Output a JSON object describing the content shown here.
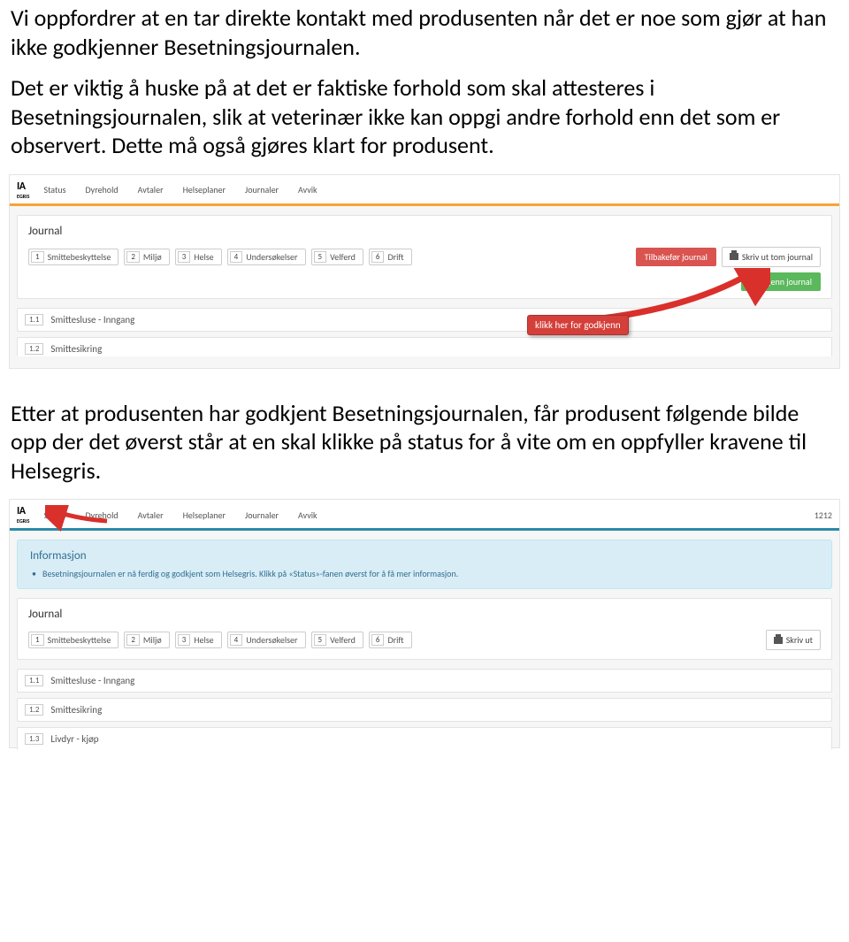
{
  "paragraphs": {
    "p1": "Vi oppfordrer at en tar direkte kontakt med produsenten når det er noe som gjør at han ikke godkjenner Besetningsjournalen.",
    "p2": "Det er viktig å huske på at det er faktiske forhold som skal attesteres i Besetningsjournalen, slik at veterinær ikke kan oppgi andre forhold enn det som er observert. Dette må også gjøres klart for produsent.",
    "p3": "Etter at produsenten har godkjent Besetningsjournalen, får produsent følgende bilde opp der det øverst står at en skal klikke på status for å vite om en oppfyller kravene til Helsegris."
  },
  "logo": {
    "main": "IA",
    "sub": "EGRIS"
  },
  "nav1": {
    "items": [
      "Status",
      "Dyrehold",
      "Avtaler",
      "Helseplaner",
      "Journaler",
      "Avvik"
    ]
  },
  "ss1": {
    "panel_title": "Journal",
    "tabs": [
      {
        "num": "1",
        "label": "Smittebeskyttelse"
      },
      {
        "num": "2",
        "label": "Miljø"
      },
      {
        "num": "3",
        "label": "Helse"
      },
      {
        "num": "4",
        "label": "Undersøkelser"
      },
      {
        "num": "5",
        "label": "Velferd"
      },
      {
        "num": "6",
        "label": "Drift"
      }
    ],
    "btn_red": "Tilbakefør journal",
    "btn_print": "Skriv ut tom journal",
    "btn_green": "Godkjenn journal",
    "subrows": [
      {
        "num": "1.1",
        "label": "Smittesluse - Inngang"
      },
      {
        "num": "1.2",
        "label": "Smittesikring"
      }
    ],
    "callout": "klikk her for godkjenn"
  },
  "ss2": {
    "topright": "1212",
    "info_title": "Informasjon",
    "info_text": "Besetningsjournalen er nå ferdig og godkjent som Helsegris. Klikk på «Status»-fanen øverst for å få mer informasjon.",
    "panel_title": "Journal",
    "tabs": [
      {
        "num": "1",
        "label": "Smittebeskyttelse"
      },
      {
        "num": "2",
        "label": "Miljø"
      },
      {
        "num": "3",
        "label": "Helse"
      },
      {
        "num": "4",
        "label": "Undersøkelser"
      },
      {
        "num": "5",
        "label": "Velferd"
      },
      {
        "num": "6",
        "label": "Drift"
      }
    ],
    "btn_print": "Skriv ut",
    "subrows": [
      {
        "num": "1.1",
        "label": "Smittesluse - Inngang"
      },
      {
        "num": "1.2",
        "label": "Smittesikring"
      },
      {
        "num": "1.3",
        "label": "Livdyr - kjøp"
      }
    ]
  }
}
